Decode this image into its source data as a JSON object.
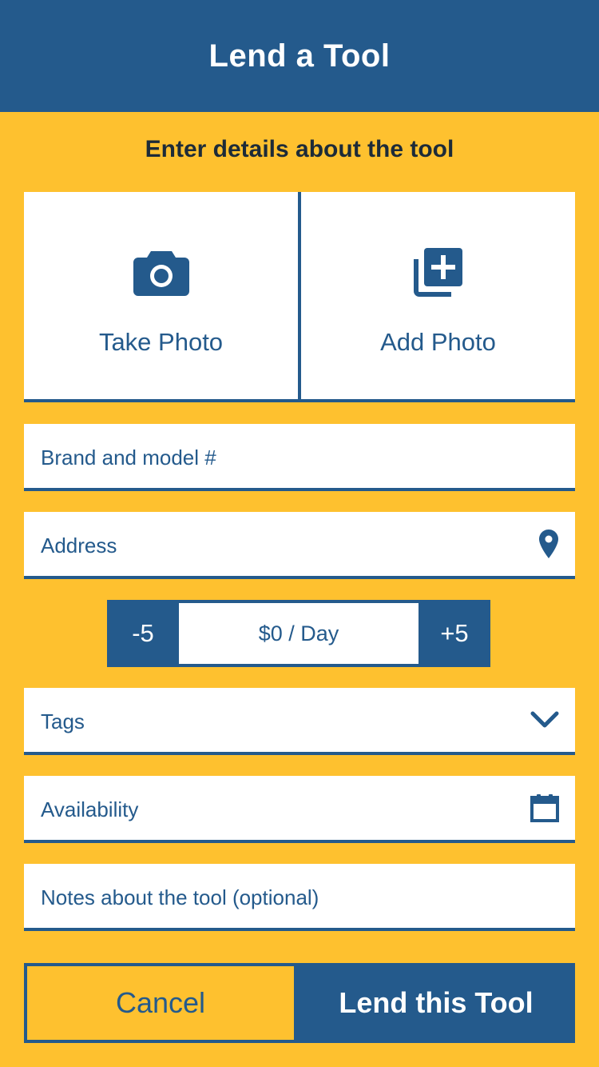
{
  "header": {
    "title": "Lend a Tool"
  },
  "subtitle": "Enter details about the tool",
  "photo": {
    "take_label": "Take Photo",
    "take_icon": "camera-icon",
    "add_label": "Add Photo",
    "add_icon": "add-photo-icon"
  },
  "fields": {
    "brand_placeholder": "Brand and model #",
    "address_placeholder": "Address",
    "address_icon": "location-pin-icon",
    "tags_placeholder": "Tags",
    "tags_icon": "chevron-down-icon",
    "availability_placeholder": "Availability",
    "availability_icon": "calendar-icon",
    "notes_placeholder": "Notes about the tool (optional)"
  },
  "price": {
    "decrement_label": "-5",
    "value_label": "$0 / Day",
    "increment_label": "+5"
  },
  "actions": {
    "cancel_label": "Cancel",
    "submit_label": "Lend this Tool"
  },
  "colors": {
    "primary": "#245A8C",
    "background": "#FEC12F",
    "surface": "#FFFFFF"
  }
}
